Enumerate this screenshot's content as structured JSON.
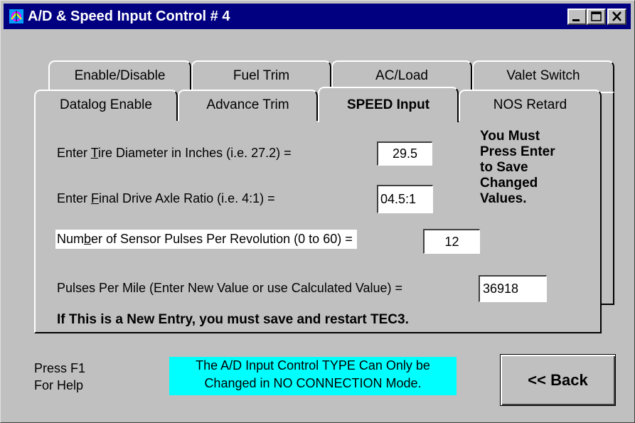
{
  "window": {
    "title": "A/D & Speed Input Control # 4",
    "title_bar_color": "#000080",
    "background_color": "#c0c0c0",
    "controls": [
      "minimize-icon",
      "maximize-icon",
      "close-icon"
    ]
  },
  "tabs": {
    "row1": [
      "Enable/Disable",
      "Fuel Trim",
      "AC/Load",
      "Valet Switch"
    ],
    "row2": [
      "Datalog Enable",
      "Advance Trim",
      "SPEED Input",
      "NOS Retard"
    ],
    "active": "SPEED Input"
  },
  "speed": {
    "tire_label_before": "Enter ",
    "tire_label_key": "T",
    "tire_label_after": "ire Diameter in Inches (i.e. 27.2)  =",
    "tire_value": "29.5",
    "ratio_label_before": "Enter ",
    "ratio_label_key": "F",
    "ratio_label_after": "inal Drive Axle Ratio (i.e. 4:1)  =",
    "ratio_value": "04.5:1",
    "pulses_label_before": "Num",
    "pulses_label_key": "b",
    "pulses_label_after": "er of Sensor Pulses Per Revolution (0 to 60) =",
    "pulses_value": "12",
    "ppm_label": "Pulses Per Mile (Enter New Value or use Calculated Value) =",
    "ppm_value": "36918",
    "warning_lines": [
      "You Must",
      "Press Enter",
      "to Save",
      "Changed",
      "Values."
    ],
    "new_entry_note": "If This is a New Entry,  you must save and restart TEC3."
  },
  "footer": {
    "help_line1": "Press F1",
    "help_line2": "For Help",
    "notice_line1": "The A/D Input Control TYPE Can Only be",
    "notice_line2": "Changed in NO CONNECTION Mode.",
    "notice_color": "#00ffff",
    "back_label": "<< Back"
  }
}
